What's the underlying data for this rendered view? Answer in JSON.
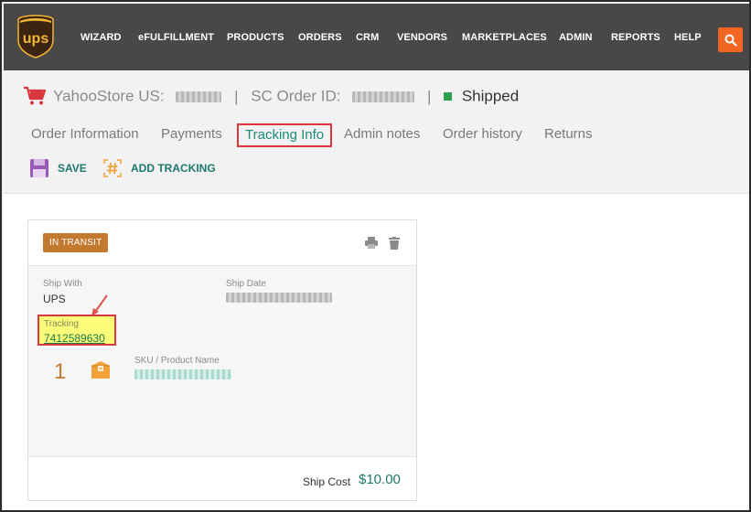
{
  "nav": {
    "logo_text": "ups",
    "items": [
      "WIZARD",
      "eFULFILLMENT",
      "PRODUCTS",
      "ORDERS",
      "CRM",
      "VENDORS",
      "MARKETPLACES",
      "ADMIN",
      "REPORTS",
      "HELP"
    ],
    "search_icon": "search-icon"
  },
  "header": {
    "store_label": "YahooStore US:",
    "order_label": "SC Order ID:",
    "separator": "|",
    "status": "Shipped",
    "status_color": "#2e9e4f"
  },
  "tabs": [
    "Order Information",
    "Payments",
    "Tracking Info",
    "Admin notes",
    "Order history",
    "Returns"
  ],
  "active_tab": "Tracking Info",
  "actions": {
    "save_label": "SAVE",
    "add_tracking_label": "ADD TRACKING"
  },
  "card": {
    "status_badge": "IN TRANSIT",
    "ship_with_label": "Ship With",
    "ship_with_value": "UPS",
    "ship_date_label": "Ship Date",
    "tracking_label": "Tracking",
    "tracking_number": "7412589630",
    "quantity": "1",
    "sku_label": "SKU / Product Name",
    "ship_cost_label": "Ship Cost",
    "ship_cost_value": "$10.00"
  },
  "colors": {
    "accent": "#1d7a6a",
    "badge": "#c37a2f",
    "highlight": "#fbfb7a",
    "outline": "#d9363e",
    "nav_bg": "#4a4846",
    "search_bg": "#f26522"
  }
}
